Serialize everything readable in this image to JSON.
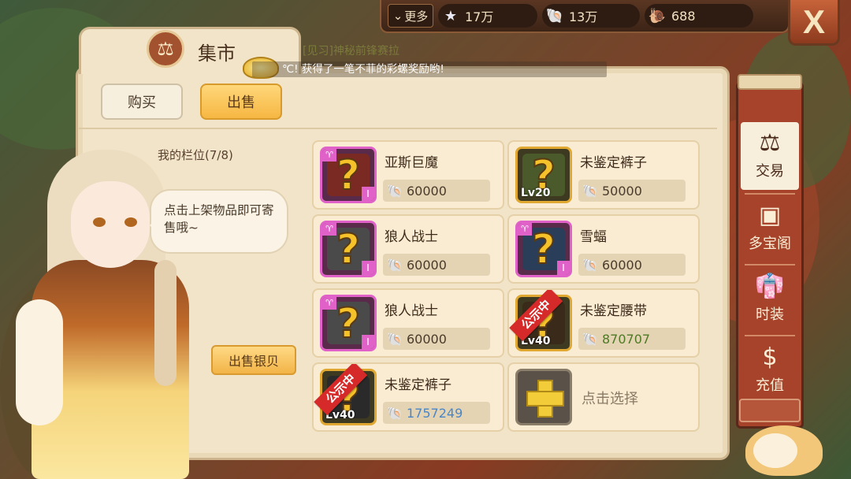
{
  "topbar": {
    "more_label": "更多",
    "stars": "17万",
    "shells": "13万",
    "gems": "688",
    "close_label": "X"
  },
  "panel": {
    "title": "集市",
    "marquee_name": "[见习]神秘前锋赛拉",
    "marquee_text": "℃! 获得了一笔不菲的彩螺奖励哟!",
    "tab_buy": "购买",
    "tab_sell": "出售",
    "slot_label": "我的栏位(7/8)",
    "bubble_text": "点击上架物品即可寄售哦~",
    "sell_silver": "出售银贝"
  },
  "items": [
    {
      "name": "亚斯巨魔",
      "price": "60000",
      "frame": "pink",
      "lv": "",
      "ribbon": ""
    },
    {
      "name": "未鉴定裤子",
      "price": "50000",
      "frame": "gold",
      "lv": "Lv20",
      "ribbon": ""
    },
    {
      "name": "狼人战士",
      "price": "60000",
      "frame": "pink",
      "lv": "",
      "ribbon": ""
    },
    {
      "name": "雪蝠",
      "price": "60000",
      "frame": "pink",
      "lv": "",
      "ribbon": ""
    },
    {
      "name": "狼人战士",
      "price": "60000",
      "frame": "pink",
      "lv": "",
      "ribbon": ""
    },
    {
      "name": "未鉴定腰带",
      "price": "870707",
      "frame": "gold",
      "lv": "Lv40",
      "ribbon": "公示中"
    },
    {
      "name": "未鉴定裤子",
      "price": "1757249",
      "frame": "gold",
      "lv": "Lv40",
      "ribbon": "公示中"
    }
  ],
  "add_slot_label": "点击选择",
  "sidebar": {
    "trade": "交易",
    "treasure": "多宝阁",
    "fashion": "时装",
    "recharge": "充值"
  },
  "colors": {
    "accent_gold": "#f6b743",
    "panel_bg": "#f1e4c8",
    "sidebar_red": "#a6432a",
    "ribbon_red": "#d62a2a",
    "price_green": "#4e7a24",
    "price_blue": "#4a86c6"
  }
}
